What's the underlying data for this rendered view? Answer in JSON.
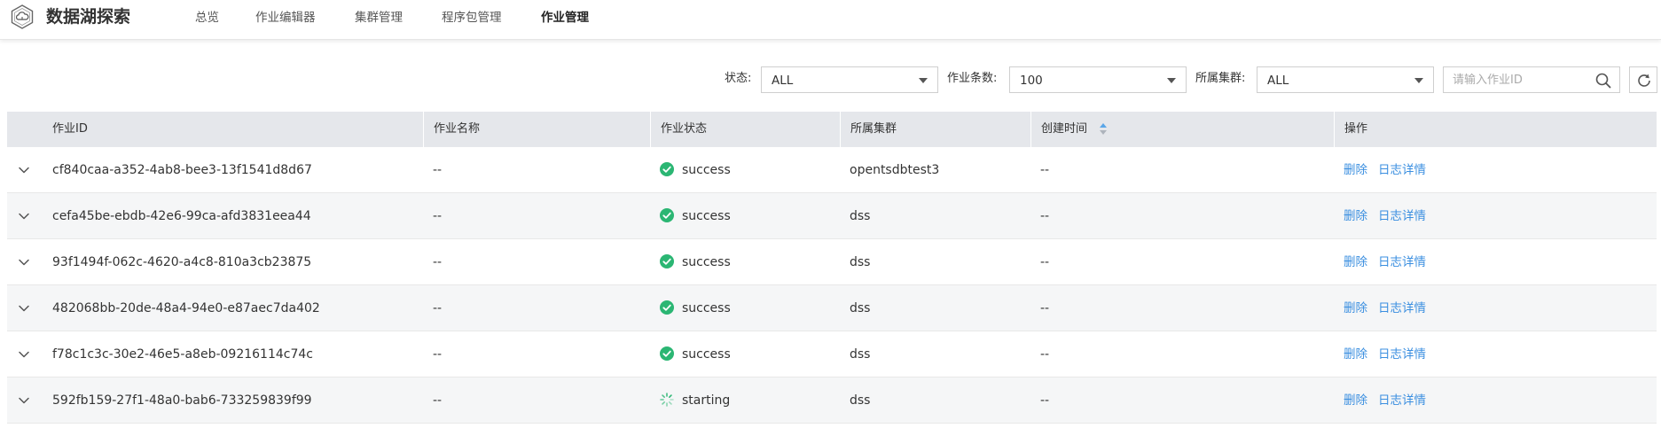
{
  "app": {
    "title": "数据湖探索",
    "logo_icon": "cloud-hexagon-icon"
  },
  "nav": {
    "items": [
      {
        "label": "总览"
      },
      {
        "label": "作业编辑器"
      },
      {
        "label": "集群管理"
      },
      {
        "label": "程序包管理"
      },
      {
        "label": "作业管理",
        "active": true
      }
    ]
  },
  "filters": {
    "status_label": "状态:",
    "status_value": "ALL",
    "count_label": "作业条数:",
    "count_value": "100",
    "cluster_label": "所属集群:",
    "cluster_value": "ALL",
    "search_placeholder": "请输入作业ID",
    "search_value": ""
  },
  "table": {
    "columns": [
      "作业ID",
      "作业名称",
      "作业状态",
      "所属集群",
      "创建时间",
      "操作"
    ],
    "actions": {
      "delete": "删除",
      "log": "日志详情"
    },
    "rows": [
      {
        "id": "cf840caa-a352-4ab8-bee3-13f1541d8d67",
        "name": "--",
        "status": "success",
        "cluster": "opentsdbtest3",
        "created": "--"
      },
      {
        "id": "cefa45be-ebdb-42e6-99ca-afd3831eea44",
        "name": "--",
        "status": "success",
        "cluster": "dss",
        "created": "--"
      },
      {
        "id": "93f1494f-062c-4620-a4c8-810a3cb23875",
        "name": "--",
        "status": "success",
        "cluster": "dss",
        "created": "--"
      },
      {
        "id": "482068bb-20de-48a4-94e0-e87aec7da402",
        "name": "--",
        "status": "success",
        "cluster": "dss",
        "created": "--"
      },
      {
        "id": "f78c1c3c-30e2-46e5-a8eb-09216114c74c",
        "name": "--",
        "status": "success",
        "cluster": "dss",
        "created": "--"
      },
      {
        "id": "592fb159-27f1-48a0-bab6-733259839f99",
        "name": "--",
        "status": "starting",
        "cluster": "dss",
        "created": "--"
      }
    ]
  },
  "colors": {
    "success": "#2bb673",
    "starting": "#2bb673",
    "link": "#3b8fe0",
    "header_bg": "#e5e7eb",
    "alt_row_bg": "#f5f6f7"
  }
}
